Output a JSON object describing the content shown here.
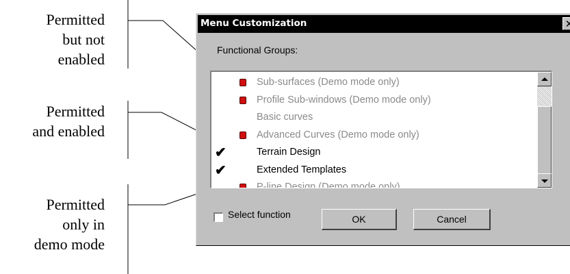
{
  "callouts": [
    {
      "lines": [
        "Permitted",
        "but not",
        "enabled"
      ]
    },
    {
      "lines": [
        "Permitted",
        "and enabled"
      ]
    },
    {
      "lines": [
        "Permitted",
        "only in",
        "demo mode"
      ]
    }
  ],
  "dialog": {
    "title": "Menu Customization",
    "close_glyph": "✕",
    "group_label": "Functional Groups:",
    "items": [
      {
        "label": "Sub-surfaces (Demo mode only)",
        "marker": "red",
        "state": "demo"
      },
      {
        "label": "Profile Sub-windows (Demo mode only)",
        "marker": "red",
        "state": "demo"
      },
      {
        "label": "Basic curves",
        "marker": "none",
        "state": "disabled"
      },
      {
        "label": "Advanced Curves (Demo mode only)",
        "marker": "red",
        "state": "demo"
      },
      {
        "label": "Terrain Design",
        "marker": "check",
        "state": "enabled"
      },
      {
        "label": "Extended Templates",
        "marker": "check",
        "state": "enabled"
      },
      {
        "label": "P-line Design (Demo mode only)",
        "marker": "red",
        "state": "demo"
      }
    ],
    "check_glyph": "✔",
    "select_function_label": "Select function",
    "select_function_checked": false,
    "ok_label": "OK",
    "cancel_label": "Cancel"
  },
  "colors": {
    "demo_marker": "#d01010",
    "disabled_text": "#8a8a8a",
    "title_bar": "#000000",
    "dialog_face": "#c0c0c0"
  }
}
